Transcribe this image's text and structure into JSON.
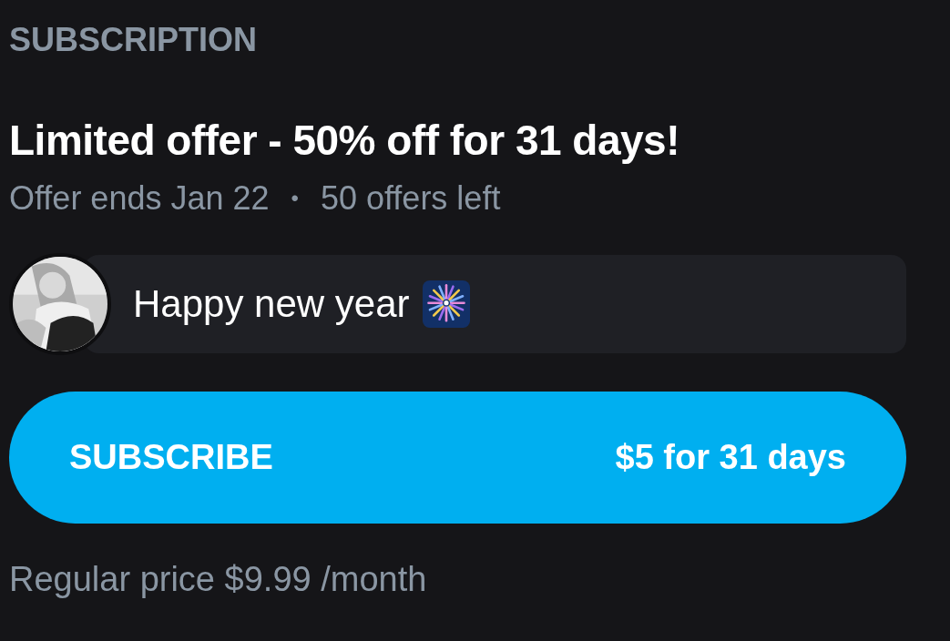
{
  "section_title": "SUBSCRIPTION",
  "offer": {
    "title": "Limited offer - 50% off for 31 days!",
    "ends": "Offer ends Jan 22",
    "separator": "•",
    "remaining": "50 offers left"
  },
  "message": {
    "text": "Happy new year"
  },
  "subscribe_button": {
    "label": "SUBSCRIBE",
    "price": "$5 for 31 days"
  },
  "regular_price": "Regular price $9.99 /month"
}
